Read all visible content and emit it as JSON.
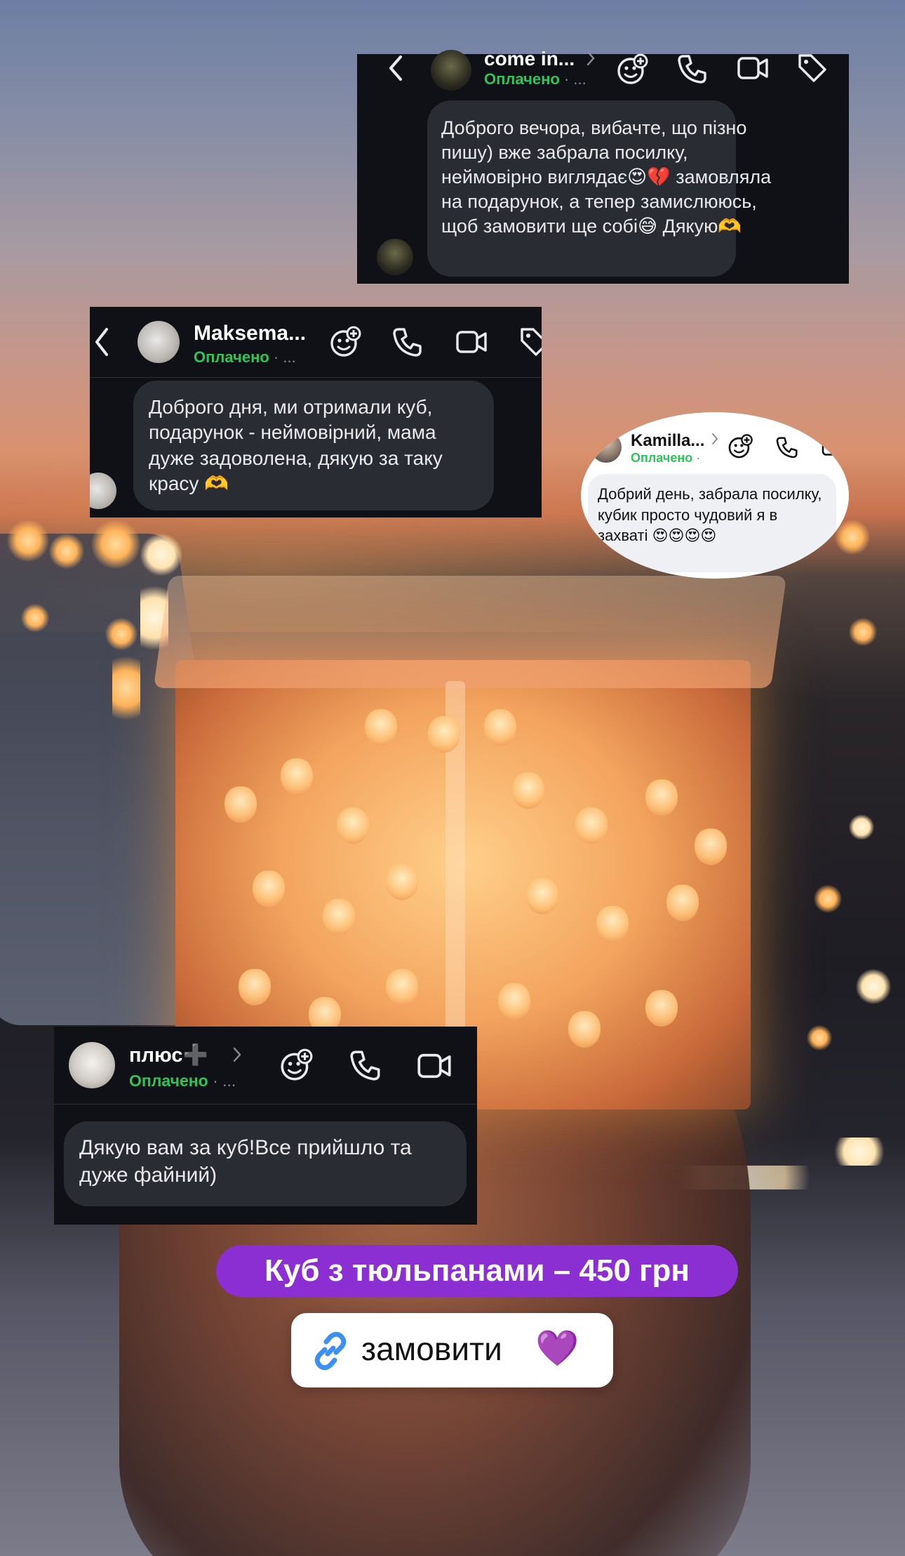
{
  "card1": {
    "name": "come in...",
    "status": "Оплачено",
    "status_suffix": " · ...",
    "message": "Доброго вечора, вибачте, що пізно пишу) вже забрала посилку, неймовірно виглядає😍💔 замовляла на подарунок, а тепер замислююсь, щоб замовити ще собі😅 Дякую🫶"
  },
  "card2": {
    "name": "Maksema...",
    "status": "Оплачено",
    "status_suffix": " · ...",
    "message": "Доброго дня, ми отримали куб, подарунок - неймовірний, мама дуже задоволена, дякую за таку красу 🫶"
  },
  "card3": {
    "name": "Kamilla...",
    "status": "Оплачено",
    "status_suffix": " ·",
    "message": "Добрий день, забрала посилку, кубик просто чудовий я в захваті 😍😍😍😍"
  },
  "card4": {
    "name": "плюс➕",
    "status": "Оплачено",
    "status_suffix": " · ...",
    "message": "Дякую вам за куб!Все прийшло та дуже файний)"
  },
  "sticker": {
    "price_text": "Куб з тюльпанами – 450 грн",
    "order_label": "замовити",
    "order_heart": "💜"
  },
  "colors": {
    "status_green": "#2fc45a",
    "price_purple": "#8b2fd3",
    "link_blue": "#3d8ff0",
    "dark_card": "#0f1116",
    "bubble_dark": "#2a2c33"
  },
  "icons": [
    "back-icon",
    "chevron-right-icon",
    "add-emoji-icon",
    "phone-icon",
    "video-icon",
    "tag-icon",
    "link-icon"
  ]
}
